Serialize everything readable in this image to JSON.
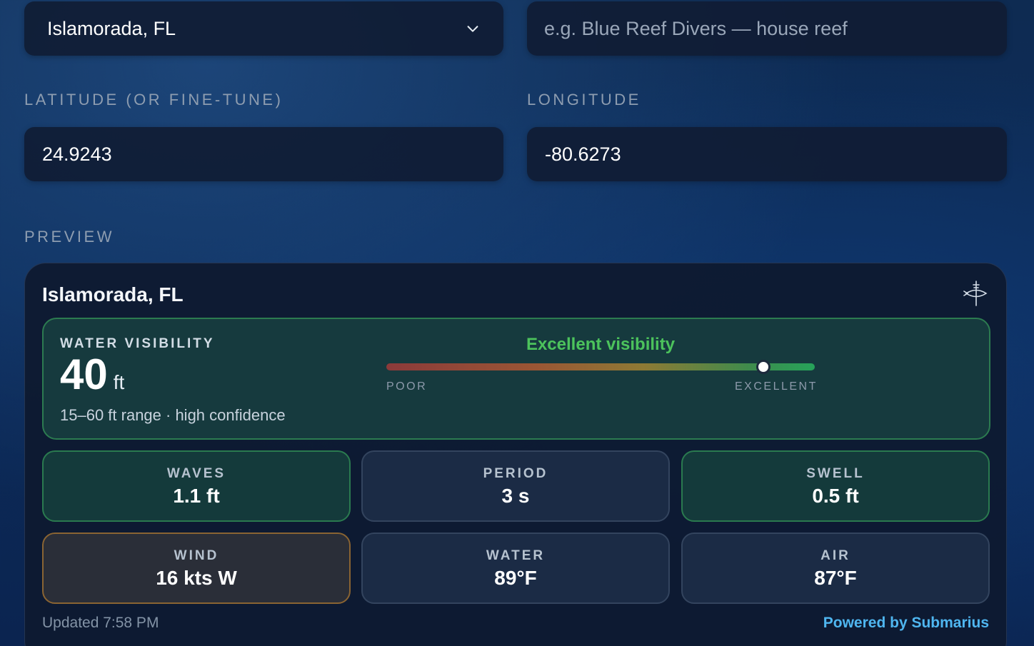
{
  "form": {
    "location_select": {
      "value": "Islamorada, FL",
      "icon": "chevron-down-icon"
    },
    "site_name": {
      "placeholder": "e.g. Blue Reef Divers — house reef"
    },
    "latitude": {
      "label": "LATITUDE (OR FINE-TUNE)",
      "value": "24.9243"
    },
    "longitude": {
      "label": "LONGITUDE",
      "value": "-80.6273"
    }
  },
  "preview": {
    "section_label": "PREVIEW",
    "card": {
      "title": "Islamorada, FL",
      "brand_icon": "submarine-logo-icon",
      "visibility": {
        "label": "WATER VISIBILITY",
        "value": "40",
        "unit": "ft",
        "range_text": "15–60 ft range · high confidence",
        "status": "Excellent visibility",
        "status_color": "#4cc35c",
        "scale_min_label": "POOR",
        "scale_max_label": "EXCELLENT",
        "scale_level": 0.88
      },
      "metrics": [
        {
          "label": "WAVES",
          "value": "1.1 ft",
          "state": "good"
        },
        {
          "label": "PERIOD",
          "value": "3 s",
          "state": "neutral"
        },
        {
          "label": "SWELL",
          "value": "0.5 ft",
          "state": "good"
        },
        {
          "label": "WIND",
          "value": "16 kts W",
          "state": "warn"
        },
        {
          "label": "WATER",
          "value": "89°F",
          "state": "neutral"
        },
        {
          "label": "AIR",
          "value": "87°F",
          "state": "neutral"
        }
      ],
      "updated": "Updated 7:58 PM",
      "powered_by": "Powered by Submarius",
      "link_color": "#4fb6f0"
    }
  }
}
